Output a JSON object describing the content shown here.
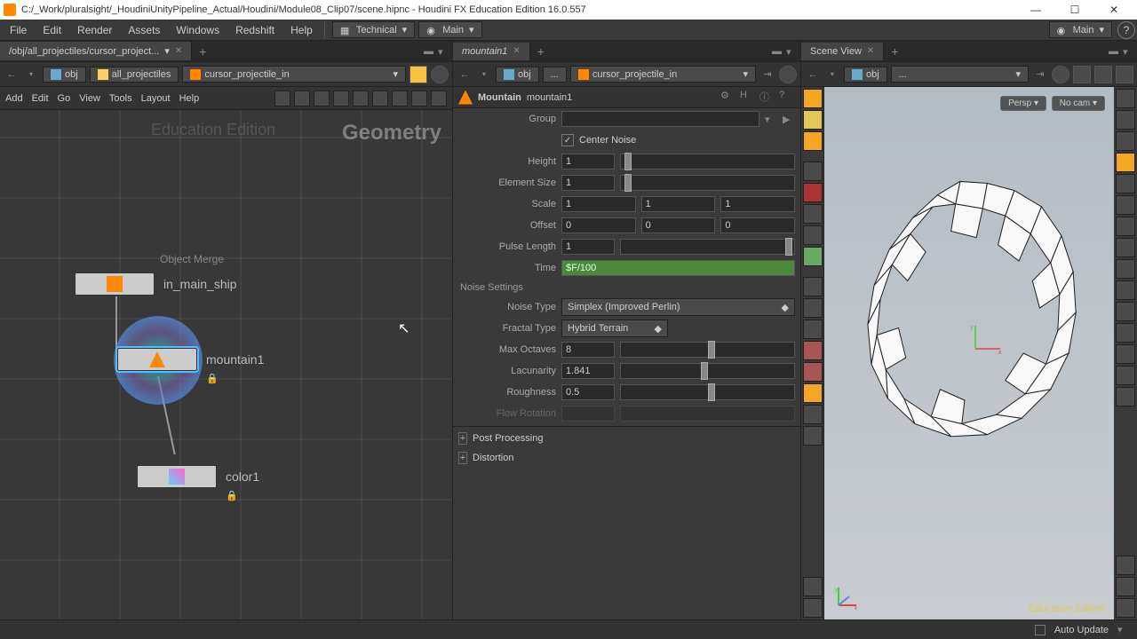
{
  "window": {
    "title": "C:/_Work/pluralsight/_HoudiniUnityPipeline_Actual/Houdini/Module08_Clip07/scene.hipnc - Houdini FX Education Edition 16.0.557"
  },
  "menu": {
    "items": [
      "File",
      "Edit",
      "Render",
      "Assets",
      "Windows",
      "Redshift",
      "Help"
    ],
    "desktop_dd": "Technical",
    "context_dd": "Main",
    "right_dd": "Main"
  },
  "network": {
    "tab_label": "/obj/all_projectiles/cursor_project...",
    "breadcrumb": [
      "obj",
      "all_projectiles",
      "cursor_projectile_in"
    ],
    "toolbar": [
      "Add",
      "Edit",
      "Go",
      "View",
      "Tools",
      "Layout",
      "Help"
    ],
    "watermark_left": "Education Edition",
    "watermark_right": "Geometry",
    "nodes": {
      "n0_sublabel": "Object Merge",
      "n0_label": "in_main_ship",
      "n1_label": "mountain1",
      "n2_label": "color1"
    }
  },
  "params": {
    "tab_label": "mountain1",
    "breadcrumb": [
      "obj",
      "...",
      "cursor_projectile_in"
    ],
    "node_type": "Mountain",
    "node_name": "mountain1",
    "group_label": "Group",
    "center_noise_label": "Center Noise",
    "height_label": "Height",
    "height_val": "1",
    "elsize_label": "Element Size",
    "elsize_val": "1",
    "scale_label": "Scale",
    "scale_x": "1",
    "scale_y": "1",
    "scale_z": "1",
    "offset_label": "Offset",
    "off_x": "0",
    "off_y": "0",
    "off_z": "0",
    "pulse_label": "Pulse Length",
    "pulse_val": "1",
    "time_label": "Time",
    "time_val": "$F/100",
    "noise_section": "Noise Settings",
    "noisetype_label": "Noise Type",
    "noisetype_val": "Simplex (Improved Perlin)",
    "fractal_label": "Fractal Type",
    "fractal_val": "Hybrid Terrain",
    "maxoct_label": "Max Octaves",
    "maxoct_val": "8",
    "lac_label": "Lacunarity",
    "lac_val": "1.841",
    "rough_label": "Roughness",
    "rough_val": "0.5",
    "flow_label": "Flow Rotation",
    "fold_post": "Post Processing",
    "fold_dist": "Distortion"
  },
  "scene": {
    "tab_label": "Scene View",
    "breadcrumb": [
      "obj",
      "..."
    ],
    "persp": "Persp ▾",
    "nocam": "No cam ▾",
    "edumark": "Education Edition"
  },
  "status": {
    "auto_update": "Auto Update"
  }
}
